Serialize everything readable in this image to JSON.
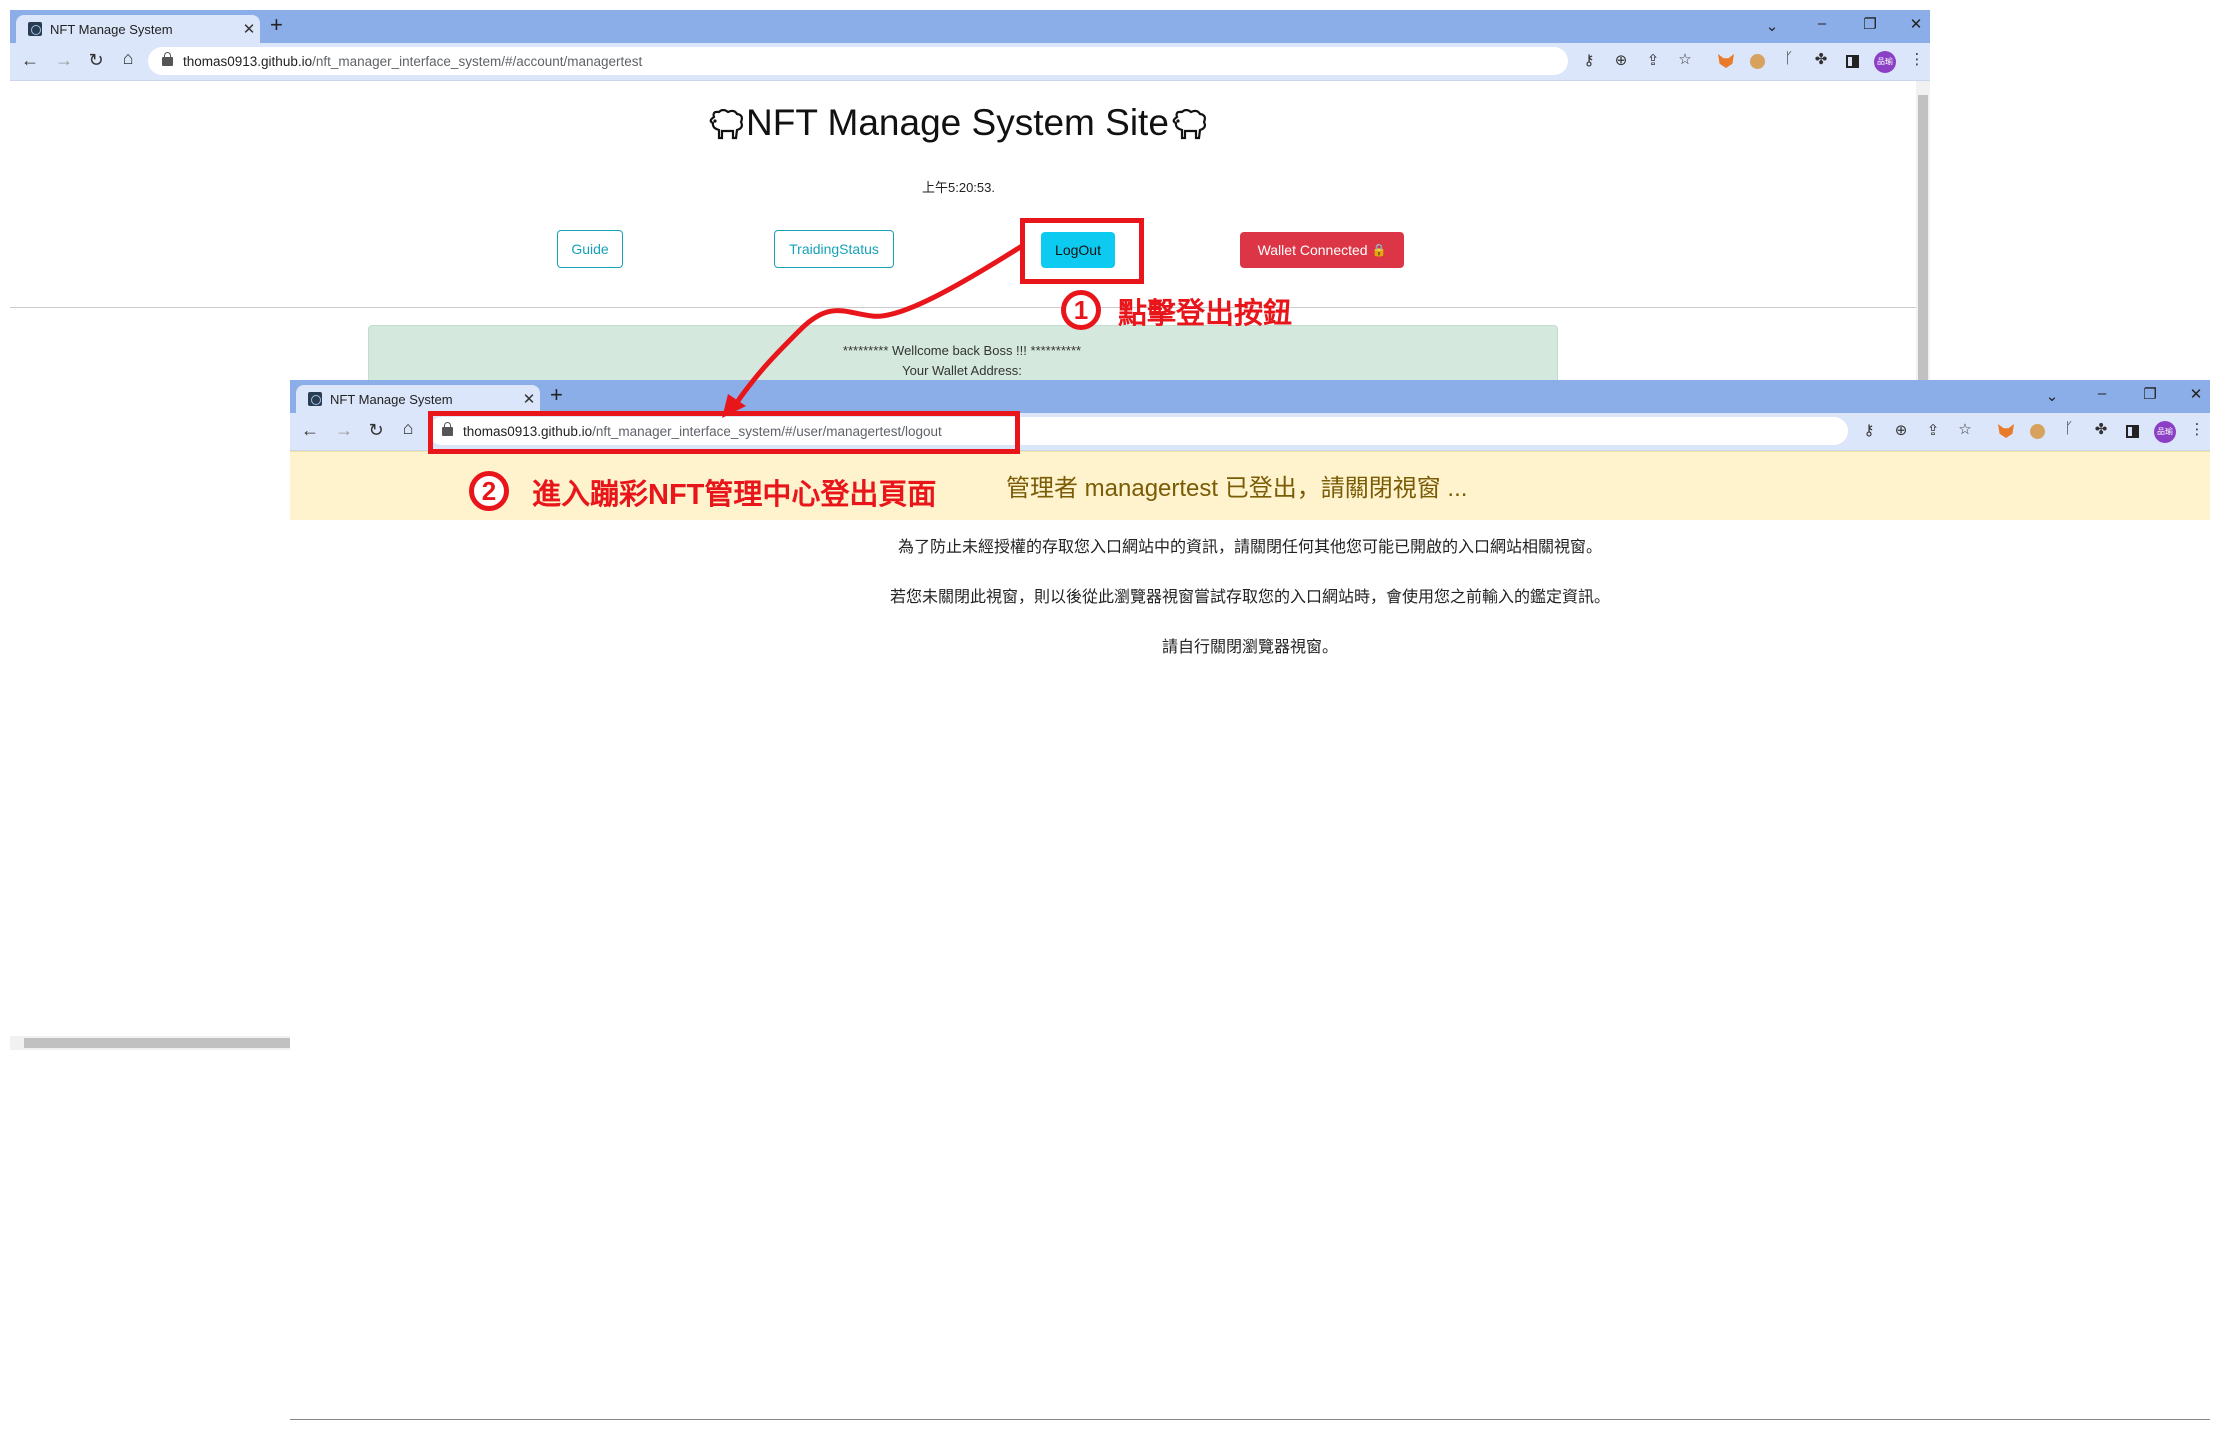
{
  "window1": {
    "tab_title": "NFT Manage System",
    "url_host": "thomas0913.github.io",
    "url_path": "/nft_manager_interface_system/#/account/managertest",
    "profile_initials": "品瑜"
  },
  "page1": {
    "site_title": "NFT Manage System Site",
    "time": "上午5:20:53.",
    "nav": {
      "guide": "Guide",
      "trading_status": "TraidingStatus",
      "logout": "LogOut",
      "wallet": "Wallet Connected",
      "wallet_icon": "🔒"
    },
    "welcome": "********* Wellcome back Boss !!! **********",
    "wallet_address_label": "Your Wallet Address:"
  },
  "window2": {
    "tab_title": "NFT Manage System",
    "url_host": "thomas0913.github.io",
    "url_path": "/nft_manager_interface_system/#/user/managertest/logout",
    "profile_initials": "品瑜"
  },
  "page2": {
    "logout_message": "管理者 managertest 已登出，請關閉視窗 ...",
    "paragraphs": [
      "為了防止未經授權的存取您入口網站中的資訊，請關閉任何其他您可能已開啟的入口網站相關視窗。",
      "若您未關閉此視窗，則以後從此瀏覽器視窗嘗試存取您的入口網站時，會使用您之前輸入的鑑定資訊。",
      "請自行關閉瀏覽器視窗。"
    ]
  },
  "annotations": {
    "step1_num": "1",
    "step1_text": "點擊登出按鈕",
    "step2_num": "2",
    "step2_text": "進入蹦彩NFT管理中心登出頁面"
  },
  "colors": {
    "annotation_red": "#e8161b",
    "logout_button": "#0dcaf0",
    "wallet_button": "#dc3545",
    "outline_button": "#17a2b8",
    "alert_yellow": "#fff3cd",
    "alert_green": "#d4e8dd"
  },
  "icons": [
    "favicon-icon",
    "close-icon",
    "new-tab-icon",
    "back-icon",
    "forward-icon",
    "reload-icon",
    "home-icon",
    "lock-icon",
    "key-icon",
    "zoom-icon",
    "share-icon",
    "star-icon",
    "metamask-icon",
    "extension-face-icon",
    "graph-icon",
    "puzzle-icon",
    "side-panel-icon",
    "menu-icon",
    "sheep-icon"
  ]
}
